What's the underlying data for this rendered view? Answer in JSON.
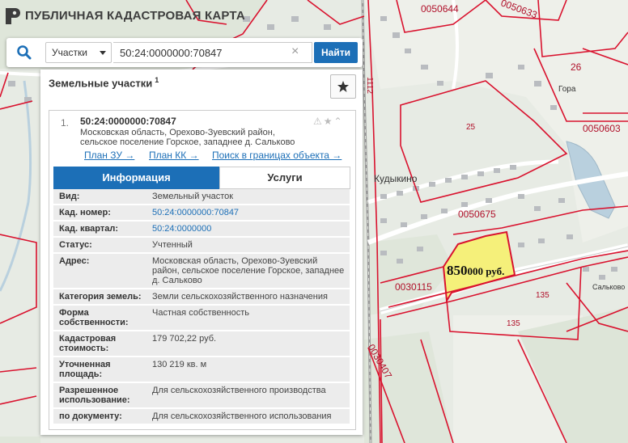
{
  "app": {
    "title": "ПУБЛИЧНАЯ КАДАСТРОВАЯ КАРТА"
  },
  "search": {
    "type_label": "Участки",
    "query": "50:24:0000000:70847",
    "find_label": "Найти"
  },
  "panel": {
    "title": "Земельные участки",
    "count": "1"
  },
  "result": {
    "index": "1.",
    "cad_number": "50:24:0000000:70847",
    "address_lines": [
      "Московская область, Орехово-Зуевский район,",
      "сельское поселение Горское, западнее д. Сальково"
    ],
    "links": [
      "План ЗУ →",
      "План КК →",
      "Поиск в границах объекта →"
    ],
    "tabs": {
      "info": "Информация",
      "services": "Услуги"
    },
    "rows": [
      {
        "label": "Вид:",
        "value": "Земельный участок"
      },
      {
        "label": "Кад. номер:",
        "value": "50:24:0000000:70847"
      },
      {
        "label": "Кад. квартал:",
        "value": "50:24:0000000"
      },
      {
        "label": "Статус:",
        "value": "Учтенный"
      },
      {
        "label": "Адрес:",
        "value": "Московская область, Орехово-Зуевский район, сельское поселение Горское, западнее д. Сальково"
      },
      {
        "label": "Категория земель:",
        "value": "Земли сельскохозяйственного назначения"
      },
      {
        "label": "Форма собственности:",
        "value": "Частная собственность"
      },
      {
        "label": "Кадастровая стоимость:",
        "value": "179 702,22 руб."
      },
      {
        "label": "Уточненная площадь:",
        "value": "130 219 кв. м"
      },
      {
        "label": "Разрешенное использование:",
        "value": "Для сельскохозяйственного производства"
      },
      {
        "label": "по документу:",
        "value": "Для сельскохозяйственного использования"
      }
    ]
  },
  "map": {
    "labels": [
      "0050644",
      "0050633",
      "26",
      "Гора",
      "0050603",
      "25",
      "Кудыкино",
      "0050675",
      "0030115",
      "135",
      "135",
      "Сальково",
      "0030407",
      "1112"
    ],
    "price": {
      "amount": "850",
      "suffix": "000 руб."
    }
  },
  "colors": {
    "accent": "#1c6fb7",
    "parcel": "#d9122e",
    "highlight": "#f5f07a"
  }
}
